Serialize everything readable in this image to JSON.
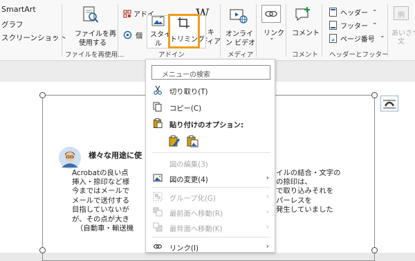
{
  "ribbon": {
    "smartart": "SmartArt",
    "graph": "グラフ",
    "screenshot": "スクリーンショット",
    "file_reuse_line1": "ファイルを再",
    "file_reuse_line2": "使用する",
    "file_reuse_group": "ファイルを再使用…",
    "addin_partial1": "アドイ",
    "addin_partial2": "個",
    "wiki_line1": "ィキ",
    "wiki_line2": "ディア",
    "addin_group": "アドイン",
    "online_video_line1": "オンライ",
    "online_video_line2": "ン ビデオ",
    "media_group": "メディア",
    "link": "リンク",
    "link_arrow": "⌄",
    "comment": "コメント",
    "comment_group": "コメント",
    "header": "ヘッダー",
    "footer": "フッター",
    "page_number": "ページ番号",
    "hf_group": "ヘッダーとフッター",
    "greeting_line1": "あいさつ",
    "greeting_line2": "文",
    "example": "例"
  },
  "mini_toolbar": {
    "style_line1": "スタイ",
    "style_line2": "ル",
    "trimming": "トリミング"
  },
  "document": {
    "heading": "様々な用途に使",
    "left_lines": [
      "Acrobatの良い点",
      "挿入・捺印など様",
      "今まではメールで",
      "メールで送付する",
      "目指していないが",
      "が、その点が大き",
      "（自動車・輸送機"
    ],
    "right_lines": [
      "イルの結合・文字の",
      "の捺印は、",
      "で取り込みそれを",
      "パーレスを",
      "発生していました",
      "",
      ""
    ]
  },
  "context_menu": {
    "search_placeholder": "メニューの検索",
    "cut": "切り取り(T)",
    "copy": "コピー(C)",
    "paste_options": "貼り付けのオプション:",
    "edit_picture": "図の編集(3)",
    "change_picture": "図の変更(4)",
    "group": "グループ化(G)",
    "bring_forward": "最前面へ移動(R)",
    "send_backward": "最背面へ移動(K)",
    "link": "リンク(I)",
    "submenu_arrow": "›"
  },
  "colors": {
    "highlight_orange": "#f29a1c",
    "accent_blue": "#1e5fa8",
    "paste_gold": "#d9a400"
  }
}
